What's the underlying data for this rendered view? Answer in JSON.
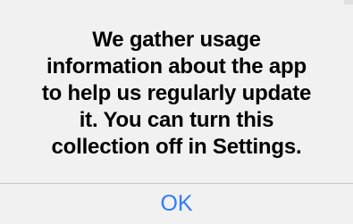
{
  "alert": {
    "message_lines": [
      "We gather usage",
      "information about the app",
      "to help us regularly update",
      "it. You can turn this",
      "collection off in Settings."
    ],
    "ok_label": "OK"
  },
  "colors": {
    "background": "#f1f1f1",
    "message_text": "#000000",
    "button_text": "#2f7df6",
    "divider": "#c8c8cc"
  }
}
